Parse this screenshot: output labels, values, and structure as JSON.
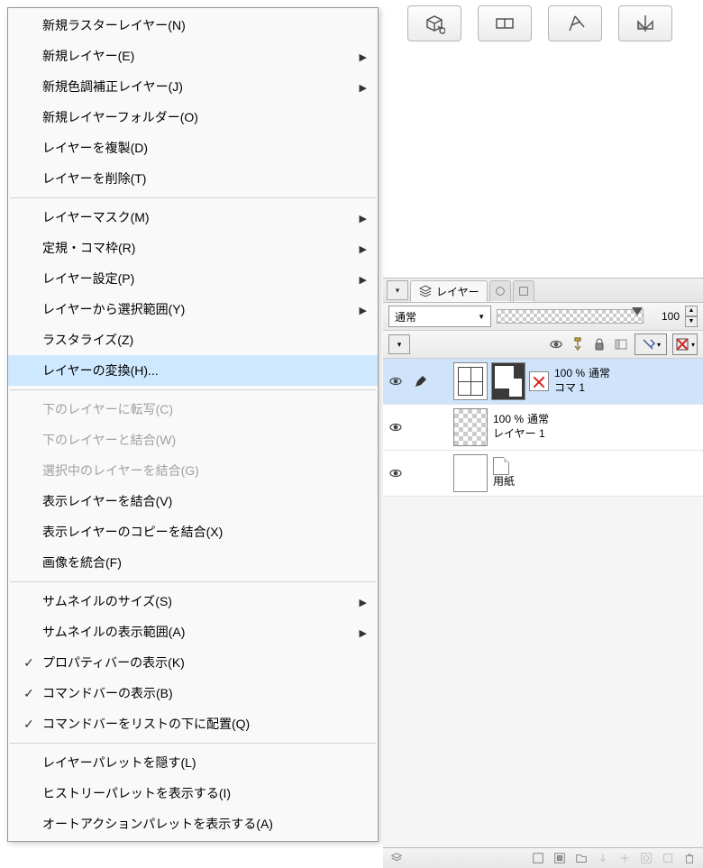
{
  "context_menu": {
    "items": [
      {
        "label": "新規ラスターレイヤー(N)",
        "submenu": false
      },
      {
        "label": "新規レイヤー(E)",
        "submenu": true
      },
      {
        "label": "新規色調補正レイヤー(J)",
        "submenu": true
      },
      {
        "label": "新規レイヤーフォルダー(O)",
        "submenu": false
      },
      {
        "label": "レイヤーを複製(D)",
        "submenu": false
      },
      {
        "label": "レイヤーを削除(T)",
        "submenu": false
      },
      {
        "sep": true
      },
      {
        "label": "レイヤーマスク(M)",
        "submenu": true
      },
      {
        "label": "定規・コマ枠(R)",
        "submenu": true
      },
      {
        "label": "レイヤー設定(P)",
        "submenu": true
      },
      {
        "label": "レイヤーから選択範囲(Y)",
        "submenu": true
      },
      {
        "label": "ラスタライズ(Z)",
        "submenu": false
      },
      {
        "label": "レイヤーの変換(H)...",
        "submenu": false,
        "highlight": true
      },
      {
        "sep": true
      },
      {
        "label": "下のレイヤーに転写(C)",
        "submenu": false,
        "disabled": true
      },
      {
        "label": "下のレイヤーと結合(W)",
        "submenu": false,
        "disabled": true
      },
      {
        "label": "選択中のレイヤーを結合(G)",
        "submenu": false,
        "disabled": true
      },
      {
        "label": "表示レイヤーを結合(V)",
        "submenu": false
      },
      {
        "label": "表示レイヤーのコピーを結合(X)",
        "submenu": false
      },
      {
        "label": "画像を統合(F)",
        "submenu": false
      },
      {
        "sep": true
      },
      {
        "label": "サムネイルのサイズ(S)",
        "submenu": true
      },
      {
        "label": "サムネイルの表示範囲(A)",
        "submenu": true
      },
      {
        "label": "プロパティバーの表示(K)",
        "submenu": false,
        "checked": true
      },
      {
        "label": "コマンドバーの表示(B)",
        "submenu": false,
        "checked": true
      },
      {
        "label": "コマンドバーをリストの下に配置(Q)",
        "submenu": false,
        "checked": true
      },
      {
        "sep": true
      },
      {
        "label": "レイヤーパレットを隠す(L)",
        "submenu": false
      },
      {
        "label": "ヒストリーパレットを表示する(I)",
        "submenu": false
      },
      {
        "label": "オートアクションパレットを表示する(A)",
        "submenu": false
      }
    ]
  },
  "layer_panel": {
    "tab_label": "レイヤー",
    "blend_mode": "通常",
    "opacity_value": "100",
    "layers": [
      {
        "opacity": "100 %",
        "mode": "通常",
        "name": "コマ 1",
        "selected": true,
        "edit": true,
        "type": "frame"
      },
      {
        "opacity": "100 %",
        "mode": "通常",
        "name": "レイヤー 1",
        "type": "raster"
      },
      {
        "name": "用紙",
        "type": "paper"
      }
    ]
  }
}
